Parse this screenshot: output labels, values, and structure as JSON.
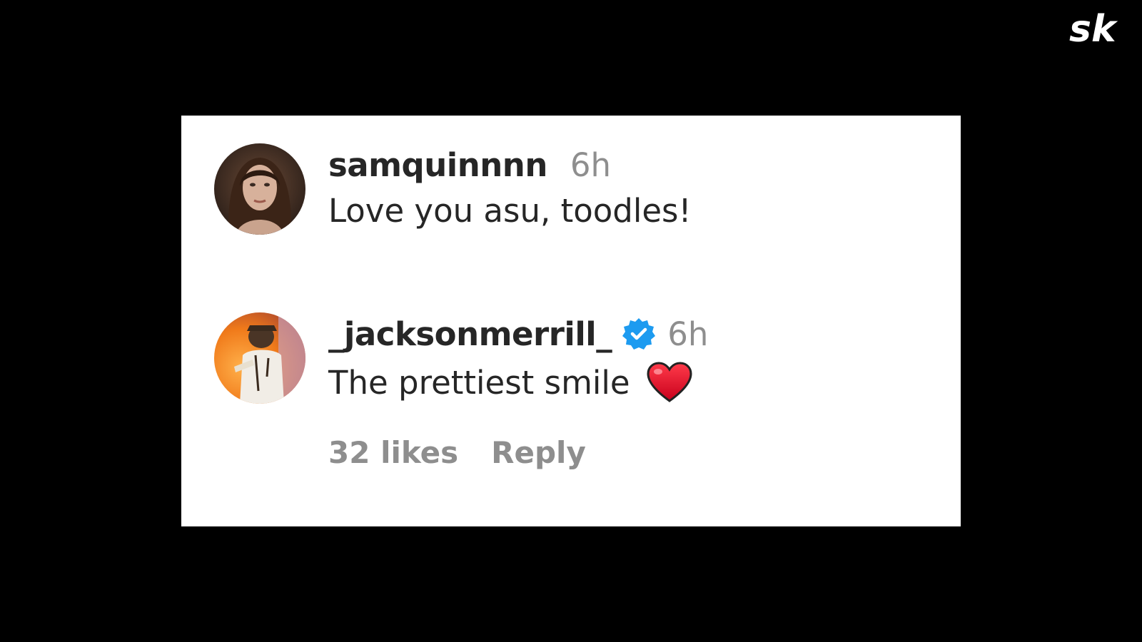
{
  "brand": {
    "logo_text": "sk",
    "logo_color": "#ffffff"
  },
  "comments": [
    {
      "username": "samquinnnn",
      "time": "6h",
      "text": "Love you asu, toodles!",
      "verified": false,
      "avatar": "avatar-samquinnnn"
    },
    {
      "username": "_jacksonmerrill_",
      "time": "6h",
      "text": "The prettiest smile",
      "emoji": "red-heart-icon",
      "verified": true,
      "avatar": "avatar-jacksonmerrill",
      "likes_label": "32 likes",
      "reply_label": "Reply"
    }
  ],
  "colors": {
    "background": "#000000",
    "card": "#ffffff",
    "text": "#262626",
    "muted": "#8e8e8e",
    "verified": "#1d9bf0",
    "heart": "#e0162b"
  }
}
